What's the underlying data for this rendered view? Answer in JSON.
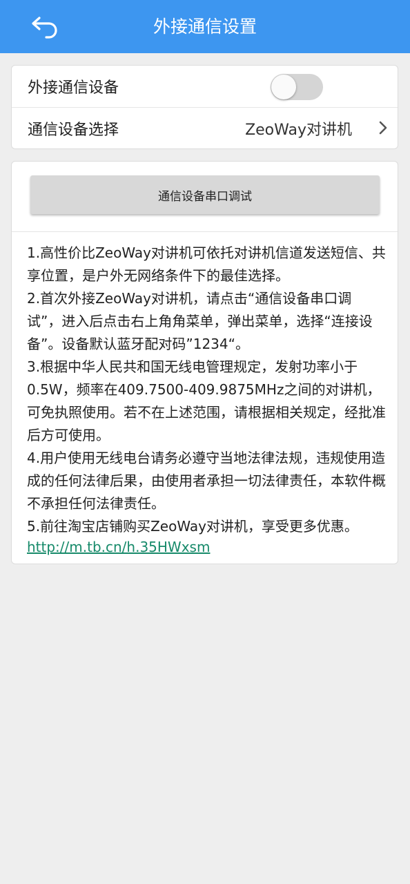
{
  "header": {
    "title": "外接通信设置",
    "back_icon": "back-arrow-icon"
  },
  "settings": {
    "external_device_label": "外接通信设备",
    "external_device_enabled": false,
    "device_select_label": "通信设备选择",
    "device_select_value": "ZeoWay对讲机",
    "chevron_icon": "chevron-right-icon"
  },
  "debug": {
    "button_label": "通信设备串口调试"
  },
  "notes": [
    "1.高性价比ZeoWay对讲机可依托对讲机信道发送短信、共享位置，是户外无网络条件下的最佳选择。",
    "2.首次外接ZeoWay对讲机，请点击“通信设备串口调试”，进入后点击右上角角菜单，弹出菜单，选择“连接设备”。设备默认蓝牙配对码”1234“。",
    "3.根据中华人民共和国无线电管理规定，发射功率小于0.5W，频率在409.7500-409.9875MHz之间的对讲机，可免执照使用。若不在上述范围，请根据相关规定，经批准后方可使用。",
    "4.用户使用无线电台请务必遵守当地法律法规，违规使用造成的任何法律后果，由使用者承担一切法律责任，本软件概不承担任何法律责任。",
    "5.前往淘宝店铺购买ZeoWay对讲机，享受更多优惠。"
  ],
  "link": "http://m.tb.cn/h.35HWxsm",
  "colors": {
    "header_bg": "#3d96f0",
    "link": "#178a6a",
    "page_bg": "#eeeeee"
  }
}
